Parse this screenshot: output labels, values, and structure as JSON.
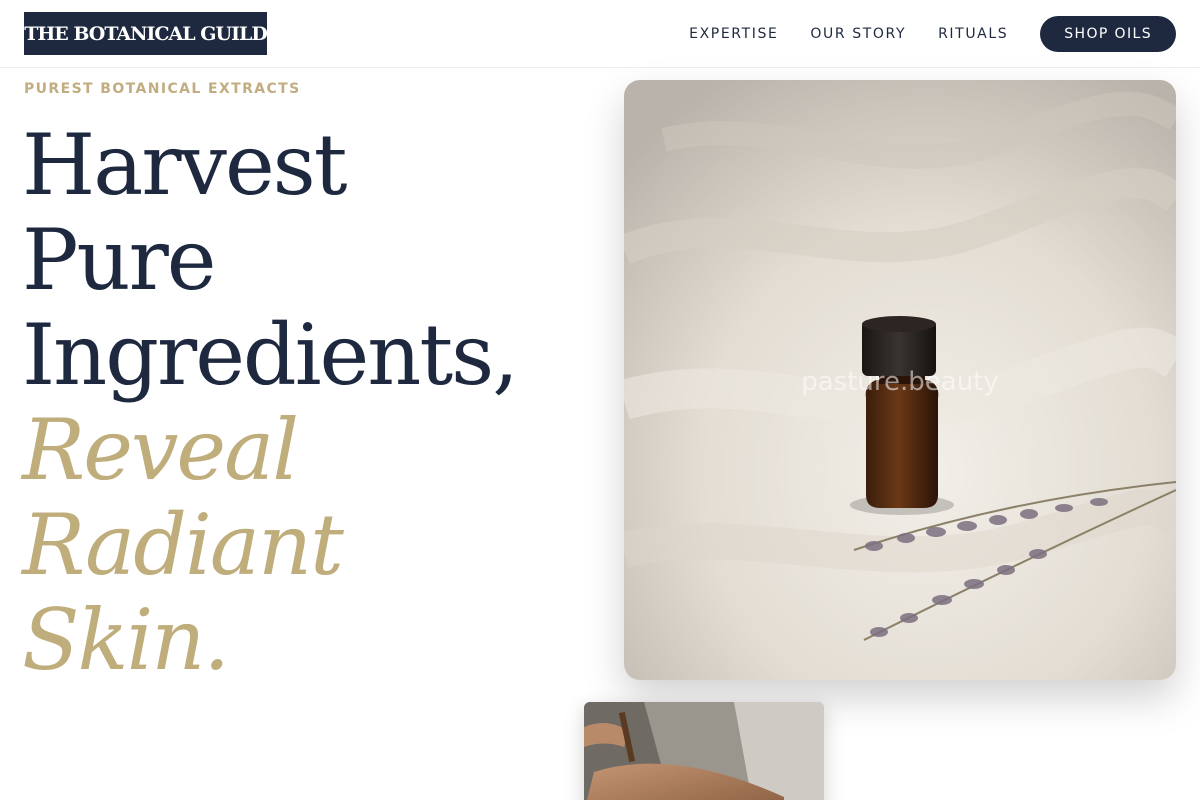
{
  "header": {
    "logo_text": "THE BOTANICAL GUILD",
    "nav": [
      {
        "label": "EXPERTISE"
      },
      {
        "label": "OUR STORY"
      },
      {
        "label": "RITUALS"
      }
    ],
    "cta_label": "SHOP OILS"
  },
  "hero": {
    "eyebrow": "PUREST BOTANICAL EXTRACTS",
    "headline_lines": [
      {
        "text": "Harvest"
      },
      {
        "text": "Pure"
      },
      {
        "text": "Ingredients,"
      },
      {
        "text": "Reveal"
      },
      {
        "text": "Radiant"
      },
      {
        "text": "Skin."
      }
    ],
    "image_watermark": "pasture.beauty"
  },
  "colors": {
    "navy": "#1e2940",
    "gold": "#c0ad7c",
    "eyebrow_gold": "#c2ad80"
  }
}
